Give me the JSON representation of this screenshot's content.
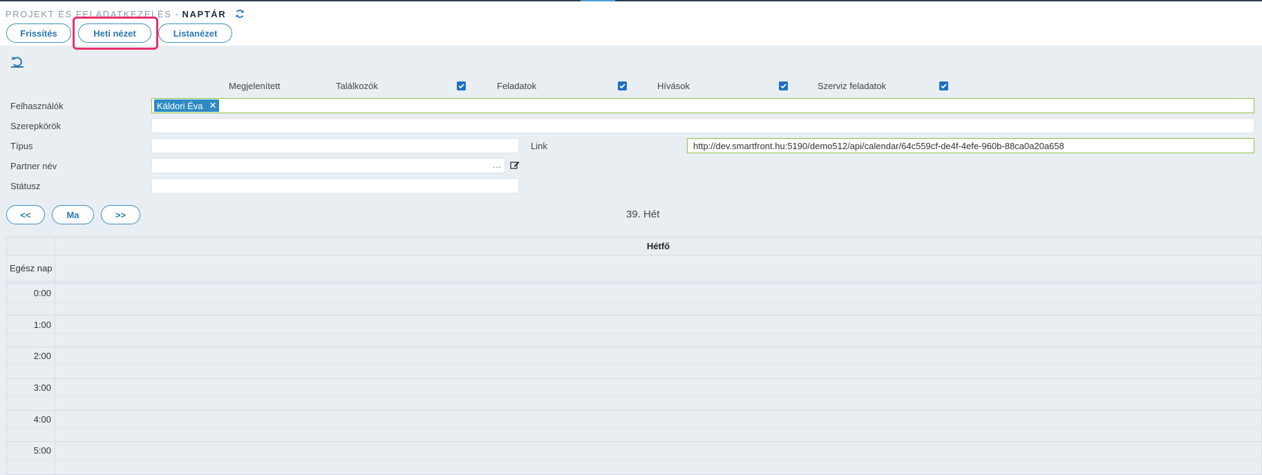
{
  "header": {
    "section": "PROJEKT ÉS FELADATKEZELÉS -",
    "title": "NAPTÁR",
    "buttons": {
      "refresh": "Frissítés",
      "week_view": "Heti nézet",
      "list_view": "Listanézet"
    }
  },
  "filters": {
    "display_label": "Megjelenített",
    "types": [
      {
        "label": "Találkozók",
        "checked": true
      },
      {
        "label": "Feladatok",
        "checked": true
      },
      {
        "label": "Hívások",
        "checked": true
      },
      {
        "label": "Szerviz feladatok",
        "checked": true
      }
    ],
    "users_label": "Felhasználók",
    "users_tag": "Káldori Éva",
    "roles_label": "Szerepkörök",
    "type_label": "Típus",
    "link_label": "Link",
    "link_value": "http://dev.smartfront.hu:5190/demo512/api/calendar/64c559cf-de4f-4efe-960b-88ca0a20a658",
    "partner_label": "Partner név",
    "partner_dots": "...",
    "status_label": "Státusz"
  },
  "nav": {
    "prev": "<<",
    "today": "Ma",
    "next": ">>",
    "week_title": "39. Hét"
  },
  "calendar": {
    "day": "Hétfő",
    "all_day": "Egész nap",
    "hours": [
      "0:00",
      "1:00",
      "2:00",
      "3:00",
      "4:00",
      "5:00"
    ]
  },
  "colors": {
    "accent": "#2a78b3",
    "highlight": "#e8306a",
    "tag": "#2f8ac4",
    "valid_border": "#8fc23b"
  }
}
